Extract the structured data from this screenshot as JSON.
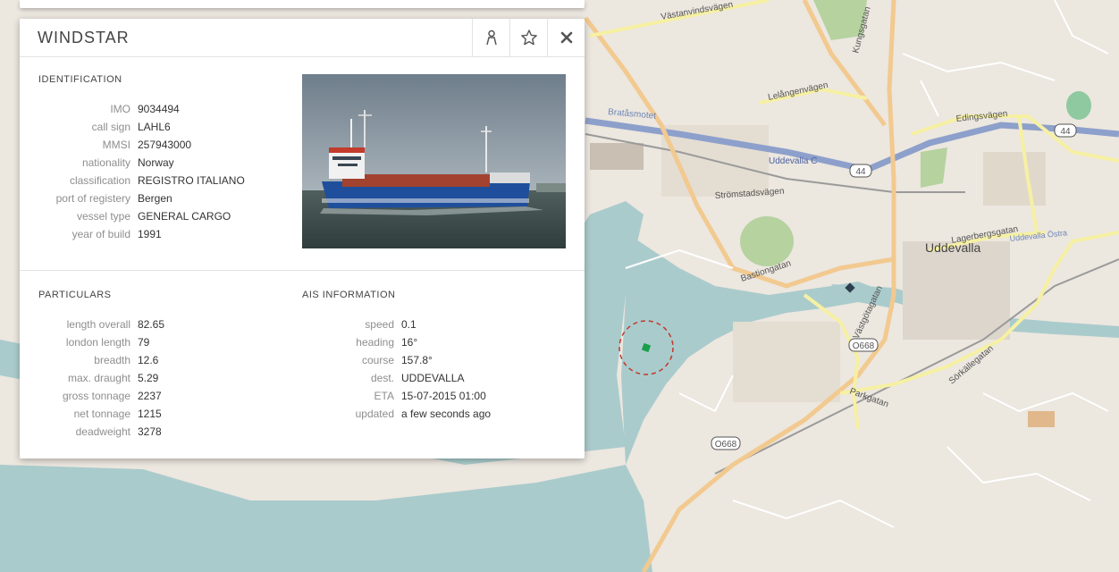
{
  "vessel": {
    "name": "WINDSTAR",
    "photo_alt": "WINDSTAR"
  },
  "header_buttons": {
    "track_icon": "person-icon",
    "favorite_icon": "star-icon",
    "close_icon": "close-icon"
  },
  "identification": {
    "title": "IDENTIFICATION",
    "rows": [
      {
        "label": "IMO",
        "value": "9034494"
      },
      {
        "label": "call sign",
        "value": "LAHL6"
      },
      {
        "label": "MMSI",
        "value": "257943000"
      },
      {
        "label": "nationality",
        "value": "Norway"
      },
      {
        "label": "classification",
        "value": "REGISTRO ITALIANO"
      },
      {
        "label": "port of registery",
        "value": "Bergen"
      },
      {
        "label": "vessel type",
        "value": "GENERAL CARGO"
      },
      {
        "label": "year of build",
        "value": "1991"
      }
    ]
  },
  "particulars": {
    "title": "PARTICULARS",
    "rows": [
      {
        "label": "length overall",
        "value": "82.65"
      },
      {
        "label": "london length",
        "value": "79"
      },
      {
        "label": "breadth",
        "value": "12.6"
      },
      {
        "label": "max. draught",
        "value": "5.29"
      },
      {
        "label": "gross tonnage",
        "value": "2237"
      },
      {
        "label": "net tonnage",
        "value": "1215"
      },
      {
        "label": "deadweight",
        "value": "3278"
      }
    ]
  },
  "ais": {
    "title": "AIS INFORMATION",
    "rows": [
      {
        "label": "speed",
        "value": "0.1"
      },
      {
        "label": "heading",
        "value": "16°"
      },
      {
        "label": "course",
        "value": "157.8°"
      },
      {
        "label": "dest.",
        "value": "UDDEVALLA"
      },
      {
        "label": "ETA",
        "value": "15-07-2015 01:00"
      },
      {
        "label": "updated",
        "value": "a few seconds ago"
      }
    ]
  },
  "map": {
    "labels": {
      "city": "Uddevalla",
      "vastanvindsvagen": "Västanvindsvägen",
      "bratasmotet": "Bratåsmotet",
      "lelangenvagen": "Lelångenvägen",
      "edingsvagen": "Edingsvägen",
      "uddevalla_c": "Uddevalla C",
      "stromstadsvagen": "Strömstadsvägen",
      "bastiongatan": "Bastiongatan",
      "lagerbergsgatan": "Lagerbergsgatan",
      "uddevalla_ostra": "Uddevalla Östra",
      "parkgatan": "Parkgatan",
      "sorkallegatan": "Sörkällegatan",
      "vastgotagatan": "Västgötagatan",
      "kungsgatan": "Kungsgatan",
      "road_44a": "44",
      "road_44b": "44",
      "road_o668a": "O668",
      "road_o668b": "O668"
    },
    "colors": {
      "water": "#aacbcc",
      "land": "#ece7df",
      "major_road": "#f2c98f",
      "secondary_road": "#f6f0a3",
      "railway": "#9a9a9a",
      "motorway": "#8da0cb",
      "park": "#b5d29f",
      "vessel_marker": "#1a9e4a",
      "selection_ring": "#c0392b"
    }
  }
}
